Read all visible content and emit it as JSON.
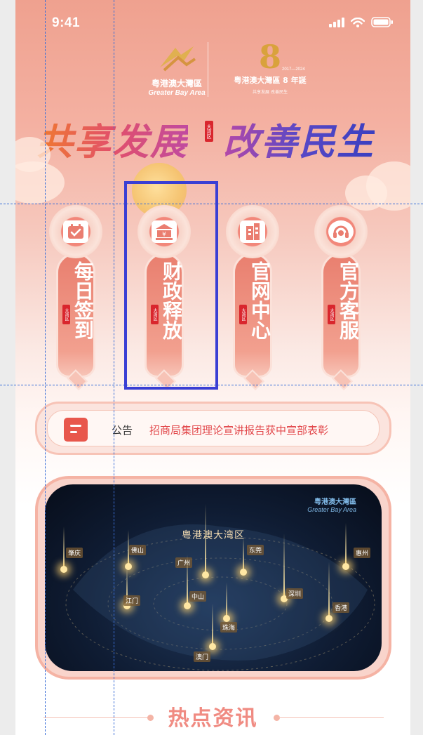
{
  "status": {
    "time": "9:41"
  },
  "logos": {
    "left_cn": "粤港澳大灣區",
    "left_en": "Greater Bay Area",
    "right_number": "8",
    "right_years": "2017—2024",
    "right_cn": "粤港澳大灣區 8 年誕",
    "right_sub": "共享发展 改善民生"
  },
  "slogan": {
    "part1": "共享发展",
    "tag": "大湾区",
    "part2": "改善民生"
  },
  "cards": [
    {
      "label": "每日签到",
      "tag": "大湾区",
      "icon": "calendar-check-icon"
    },
    {
      "label": "财政释放",
      "tag": "大湾区",
      "icon": "bank-yuan-icon"
    },
    {
      "label": "官网中心",
      "tag": "大湾区",
      "icon": "building-icon"
    },
    {
      "label": "官方客服",
      "tag": "大湾区",
      "icon": "headset-icon"
    }
  ],
  "notice": {
    "label": "公告",
    "text": "招商局集团理论宣讲报告获中宣部表彰"
  },
  "banner": {
    "brand_cn": "粤港澳大灣區",
    "brand_en": "Greater Bay Area",
    "title": "粤港澳大湾区",
    "cities": [
      "肇庆",
      "佛山",
      "广州",
      "东莞",
      "惠州",
      "江门",
      "中山",
      "深圳",
      "香港",
      "珠海",
      "澳门"
    ]
  },
  "hot": {
    "title": "热点资讯"
  },
  "colors": {
    "accent": "#e2474a",
    "selection": "#3a3fd4",
    "guide": "#3b6fd8"
  }
}
